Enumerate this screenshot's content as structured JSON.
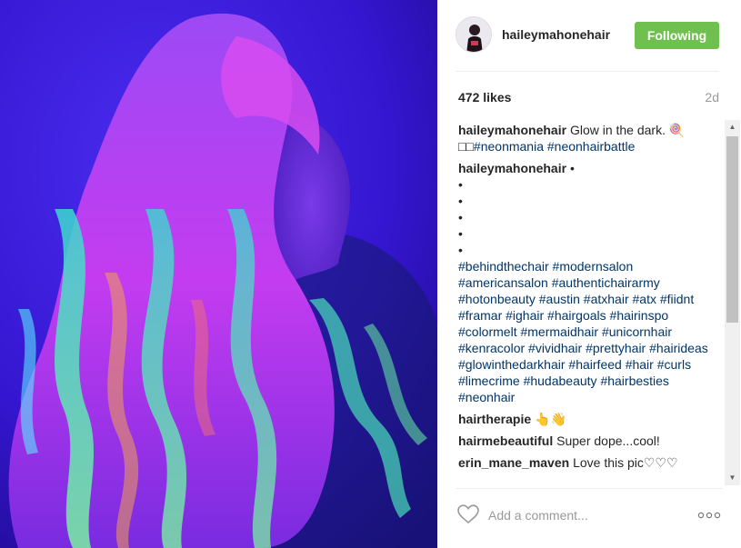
{
  "post": {
    "username": "haileymahonehair",
    "follow_label": "Following",
    "likes": "472 likes",
    "age": "2d"
  },
  "caption": {
    "user": "haileymahonehair",
    "text": "Glow in the dark. 🍭",
    "line2_prefix": "□□",
    "tags": [
      "#neonmania",
      "#neonhairbattle"
    ]
  },
  "comments": [
    {
      "user": "haileymahonehair",
      "text": "•",
      "dots": [
        "•",
        "•",
        "•",
        "•",
        "•"
      ],
      "tags": [
        "#behindthechair",
        "#modernsalon",
        "#americansalon",
        "#authentichairarmy",
        "#hotonbeauty",
        "#austin",
        "#atxhair",
        "#atx",
        "#fiidnt",
        "#framar",
        "#ighair",
        "#hairgoals",
        "#hairinspo",
        "#colormelt",
        "#mermaidhair",
        "#unicornhair",
        "#kenracolor",
        "#vividhair",
        "#prettyhair",
        "#hairideas",
        "#glowinthedarkhair",
        "#hairfeed",
        "#hair",
        "#curls",
        "#limecrime",
        "#hudabeauty",
        "#hairbesties",
        "#neonhair"
      ]
    },
    {
      "user": "hairtherapie",
      "text": "👆👋"
    },
    {
      "user": "hairmebeautiful",
      "text": "Super dope...cool!"
    },
    {
      "user": "erin_mane_maven",
      "text": "Love this pic♡♡♡"
    }
  ],
  "footer": {
    "comment_placeholder": "Add a comment...",
    "more_icon": "ellipsis-icon",
    "like_icon": "heart-icon"
  },
  "colors": {
    "follow_button": "#70c050",
    "hashtag": "#003569",
    "photo_bg": "#3a1bd6"
  }
}
